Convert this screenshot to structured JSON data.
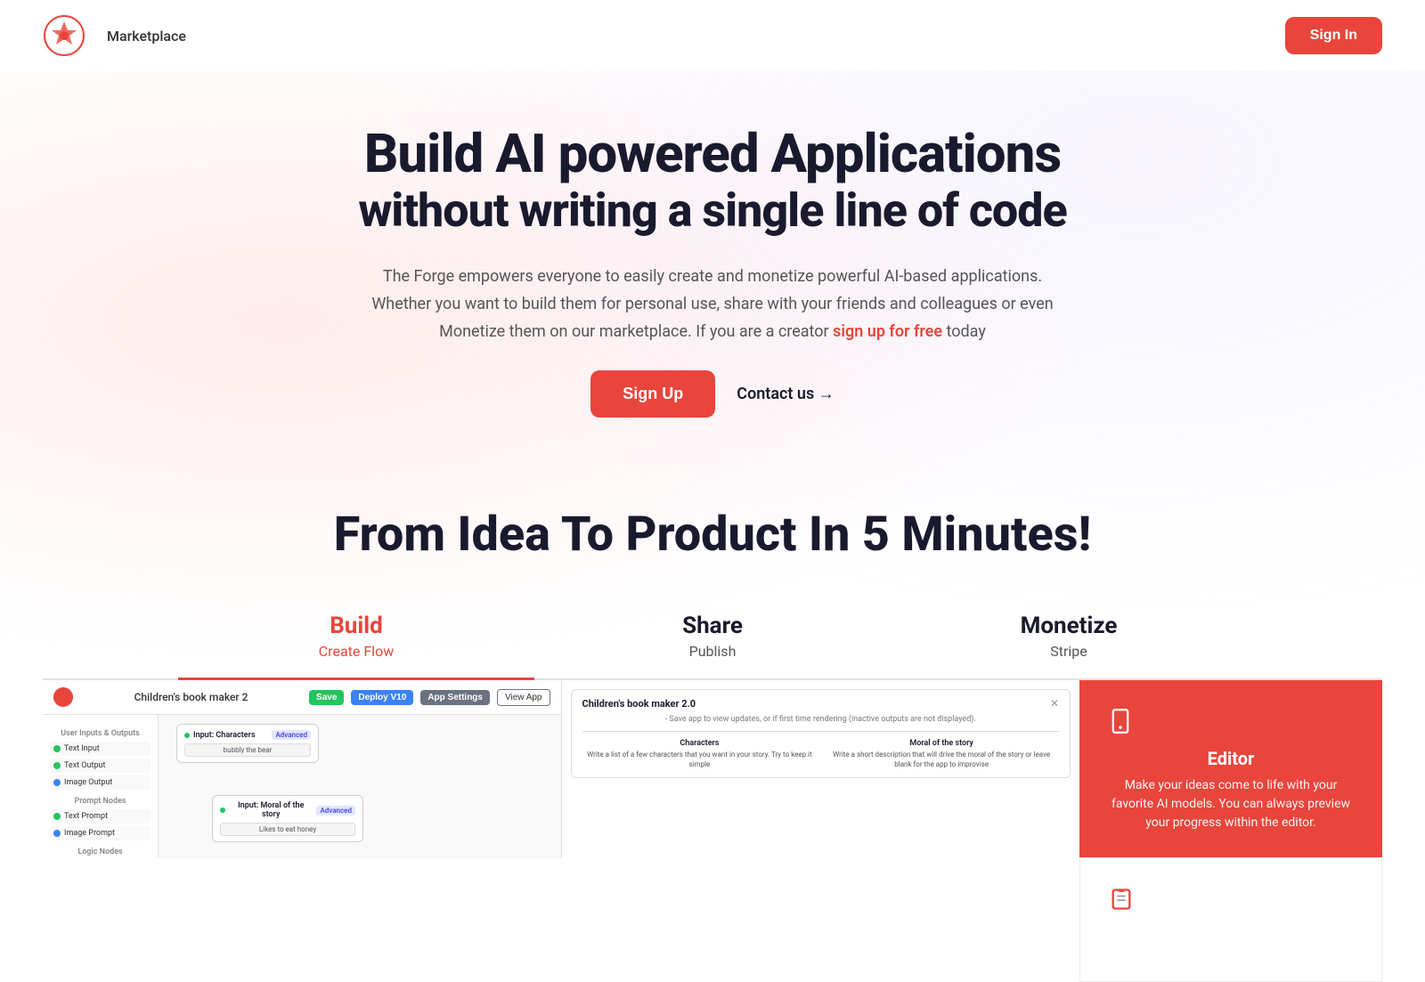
{
  "nav": {
    "marketplace_label": "Marketplace",
    "signin_label": "Sign In"
  },
  "hero": {
    "title_line1": "Build AI powered Applications",
    "title_line2": "without writing a single line of code",
    "desc_part1": "The Forge empowers everyone to easily create and monetize powerful AI-based applications. Whether you want to build them for personal use, share with your friends and colleagues or even Monetize them on our marketplace. If you are a creator ",
    "link_text": "sign up for free",
    "desc_part2": " today",
    "signup_label": "Sign Up",
    "contact_label": "Contact us →"
  },
  "features": {
    "section_title": "From Idea To Product In 5 Minutes!",
    "tabs": [
      {
        "label": "Build",
        "sublabel": "Create Flow",
        "active": true
      },
      {
        "label": "Share",
        "sublabel": "Publish",
        "active": false
      },
      {
        "label": "Monetize",
        "sublabel": "Stripe",
        "active": false
      }
    ]
  },
  "mock": {
    "app_name": "Children's book maker 2",
    "btn_save": "Save",
    "btn_deploy": "Deploy V10",
    "btn_settings": "App Settings",
    "btn_view": "View App",
    "sidebar_sections": [
      "User Inputs & Outputs",
      "Prompt Nodes",
      "Logic Nodes"
    ],
    "sidebar_items": [
      {
        "label": "Text Input",
        "type": "green"
      },
      {
        "label": "Text Output",
        "type": "green"
      },
      {
        "label": "Image Output",
        "type": "blue"
      },
      {
        "label": "Text Prompt",
        "type": "green-doc"
      },
      {
        "label": "Image Prompt",
        "type": "blue-doc"
      }
    ],
    "node1_label": "Input: Characters",
    "node1_value": "bubbly the bear",
    "node2_label": "Input: Moral of the story",
    "node2_value": "Likes to eat honey",
    "dialog_title": "Children's book maker 2.0",
    "dialog_subtitle": "- Save app to view updates, or if first time rendering (inactive outputs are not displayed).",
    "field1_label": "Characters",
    "field1_text": "Write a list of a few characters that you want in your story. Try to keep it simple",
    "field2_label": "Moral of the story",
    "field2_text": "Write a short description that will drive the moral of the story or leave blank for the app to improvise"
  },
  "editor_card": {
    "icon": "📱",
    "title": "Editor",
    "desc": "Make your ideas come to life with your favorite AI models. You can always preview your progress within the editor."
  },
  "second_card": {
    "icon": "📋",
    "title": "",
    "desc": ""
  },
  "colors": {
    "accent": "#e8453c",
    "dark": "#1a1a2e",
    "gray": "#555555"
  }
}
